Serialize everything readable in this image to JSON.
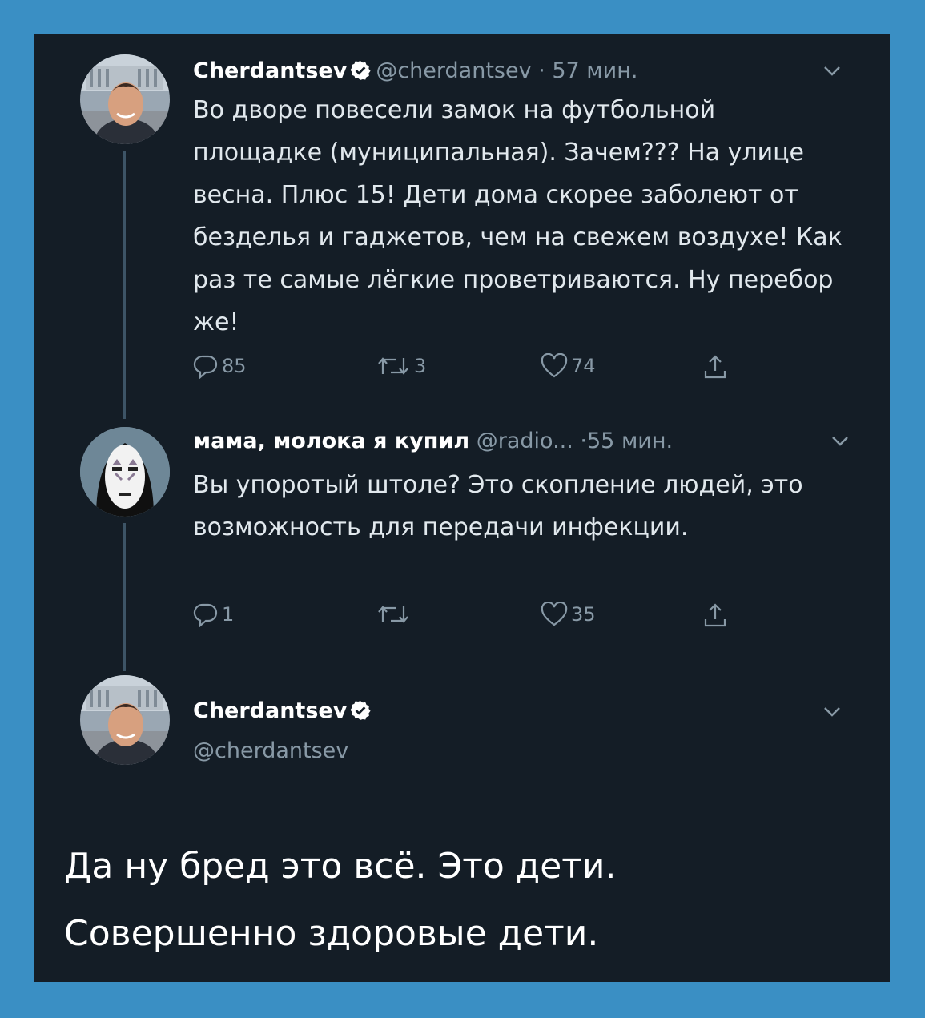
{
  "tweets": [
    {
      "name": "Cherdantsev",
      "handle": "@cherdantsev",
      "time": "57 мин.",
      "separator": "·",
      "text": "Во дворе повесели замок на футбольной площадке (муниципальная). Зачем??? На улице весна. Плюс 15! Дети дома скорее заболеют от безделья и гаджетов, чем на свежем воздухе! Как раз те самые лёгкие проветриваются. Ну перебор же!",
      "replies": "85",
      "retweets": "3",
      "likes": "74"
    },
    {
      "name": "мама, молока я купил",
      "handle": "@radio...",
      "time": "55 мин.",
      "separator": "·",
      "text": "Вы упоротый штоле? Это скопление людей, это возможность для передачи инфекции.",
      "replies": "1",
      "retweets": "",
      "likes": "35"
    }
  ],
  "main_tweet": {
    "name": "Cherdantsev",
    "handle": "@cherdantsev",
    "text_line1": "Да ну бред это всё. Это дети.",
    "text_line2": "Совершенно здоровые дети."
  },
  "colors": {
    "frame": "#3a8fc4",
    "background": "#141d26",
    "secondary_text": "#8899a6",
    "verified": "#ffffff"
  },
  "icons": [
    "chevron-down-icon",
    "verified-badge-icon",
    "reply-icon",
    "retweet-icon",
    "like-icon",
    "share-icon"
  ]
}
